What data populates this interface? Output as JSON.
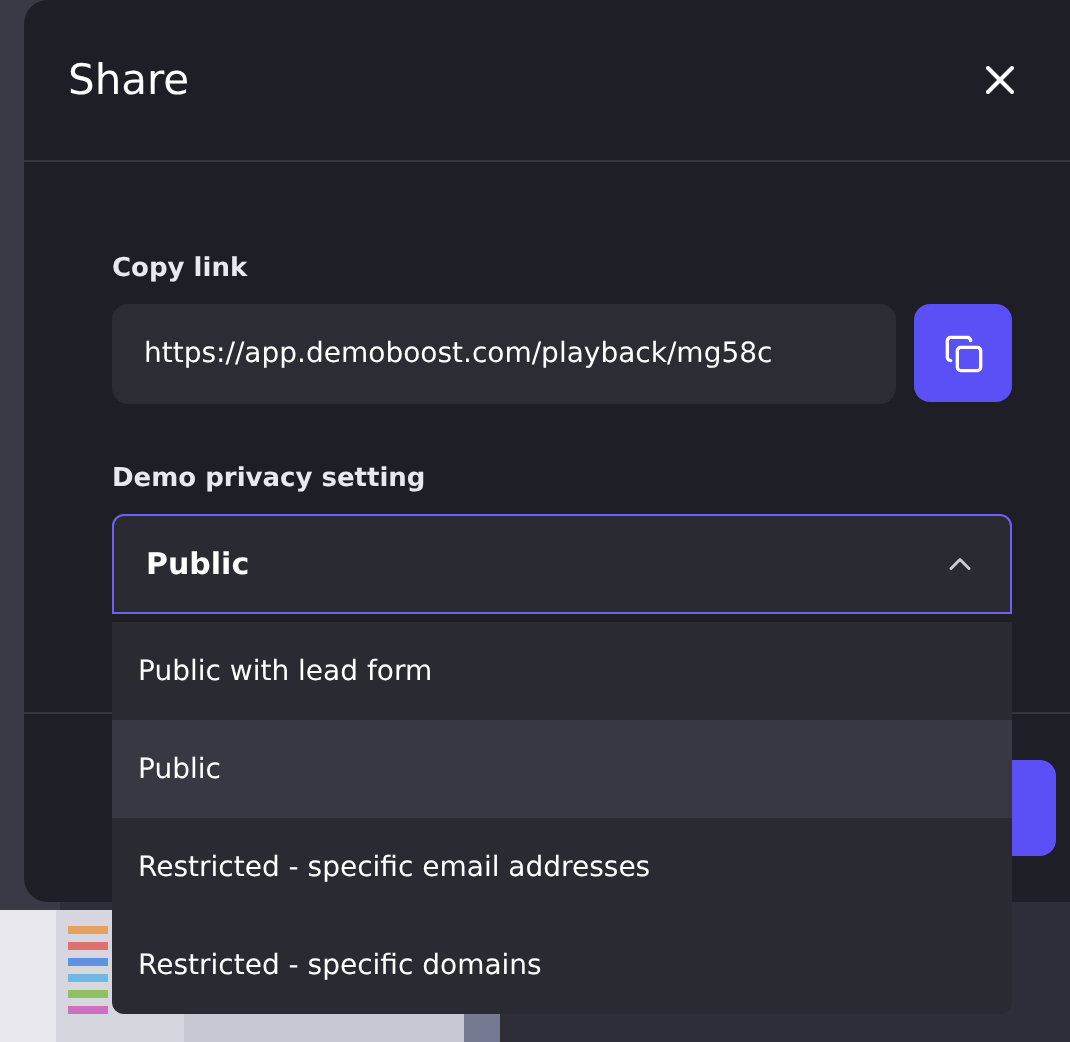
{
  "dialog": {
    "title": "Share"
  },
  "copy_link": {
    "label": "Copy link",
    "value": "https://app.demoboost.com/playback/mg58c"
  },
  "privacy": {
    "label": "Demo privacy setting",
    "value": "Public",
    "expanded": true,
    "options": [
      {
        "label": "Public with lead form",
        "selected": false
      },
      {
        "label": "Public",
        "selected": true
      },
      {
        "label": "Restricted - specific email addresses",
        "selected": false
      },
      {
        "label": "Restricted - specific domains",
        "selected": false
      }
    ]
  }
}
